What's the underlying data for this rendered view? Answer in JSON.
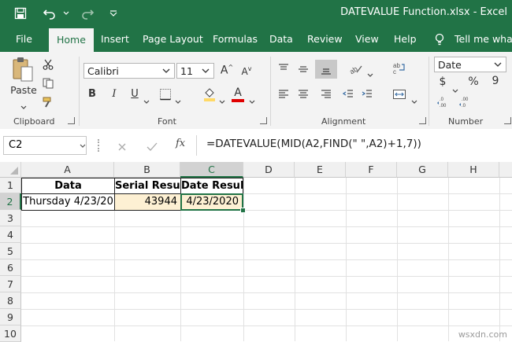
{
  "titlebar": {
    "title": "DATEVALUE Function.xlsx  -  Excel"
  },
  "tabs": [
    "File",
    "Home",
    "Insert",
    "Page Layout",
    "Formulas",
    "Data",
    "Review",
    "View",
    "Help"
  ],
  "tell_me": "Tell me what",
  "ribbon": {
    "clipboard": {
      "paste": "Paste",
      "label": "Clipboard"
    },
    "font": {
      "name": "Calibri",
      "size": "11",
      "grow": "A",
      "shrink": "A",
      "bold": "B",
      "italic": "I",
      "underline": "U",
      "font_color": "A",
      "label": "Font"
    },
    "alignment": {
      "label": "Alignment"
    },
    "number": {
      "format": "Date",
      "currency": "$",
      "percent": "%",
      "comma": "9",
      "label": "Number"
    }
  },
  "formula_bar": {
    "name_box": "C2",
    "fx": "fx",
    "formula": "=DATEVALUE(MID(A2,FIND(\" \",A2)+1,7))"
  },
  "sheet": {
    "columns": [
      "A",
      "B",
      "C",
      "D",
      "E",
      "F",
      "G",
      "H"
    ],
    "rows": [
      "1",
      "2",
      "3",
      "4",
      "5",
      "6",
      "7",
      "8",
      "9",
      "10"
    ],
    "a1": "Data",
    "b1": "Serial Result",
    "c1": "Date Result",
    "a2": "Thursday 4/23/20",
    "b2": "43944",
    "c2": "4/23/2020"
  },
  "watermark": "wsxdn.com",
  "colors": {
    "excel_green": "#217346",
    "highlight": "#fdf0d3"
  }
}
